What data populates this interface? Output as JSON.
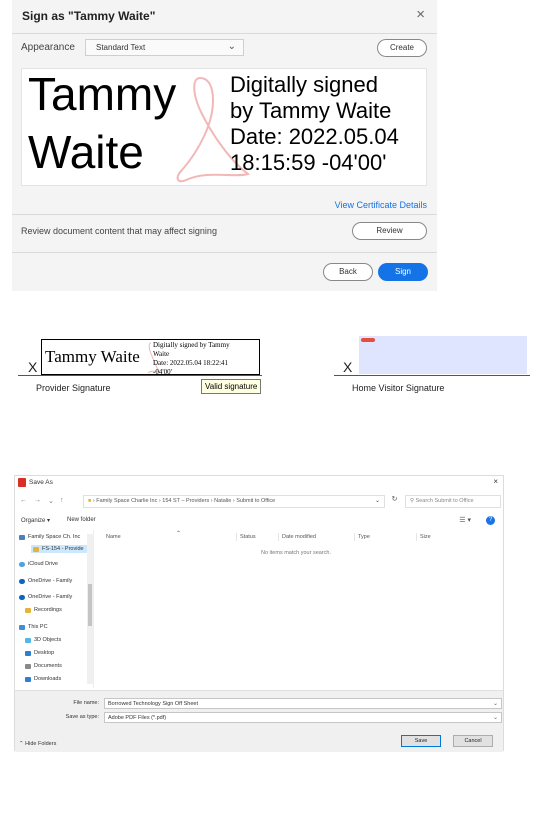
{
  "sign_dialog": {
    "title": "Sign as \"Tammy Waite\"",
    "close": "×",
    "appearance_label": "Appearance",
    "appearance_value": "Standard Text",
    "create_label": "Create",
    "preview": {
      "name_line1": "Tammy",
      "name_line2": "Waite",
      "detail_lines": [
        "Digitally signed",
        "by Tammy Waite",
        "Date: 2022.05.04",
        "18:15:59 -04'00'"
      ]
    },
    "view_certificate": "View Certificate Details",
    "review_text": "Review document content that may affect signing",
    "review_label": "Review",
    "back_label": "Back",
    "sign_label": "Sign",
    "accent_color": "#1473e6"
  },
  "signature_lines": {
    "x_mark": "X",
    "provider": {
      "caption": "Provider Signature",
      "signed_name": "Tammy Waite",
      "detail_lines": [
        "Digitally signed by Tammy",
        "Waite",
        "Date: 2022.05.04 18:22:41",
        "-04'00'"
      ],
      "tooltip": "Valid signature"
    },
    "home_visitor": {
      "caption": "Home Visitor Signature",
      "field_color": "#dfe4ff"
    }
  },
  "save_dialog": {
    "title": "Save As",
    "close": "×",
    "path": [
      "Family Space Charlie Inc",
      "154 ST – Providers",
      "Natalie",
      "Submit to Office"
    ],
    "search_placeholder": "Search Submit to Office",
    "organize_label": "Organize ▾",
    "new_folder_label": "New folder",
    "nav_items": [
      {
        "label": "Family Space Ch. Inc",
        "icon": "folder-icon"
      },
      {
        "label": "FS-154 - Provide",
        "icon": "folder-icon",
        "selected": true
      },
      {
        "label": "iCloud Drive",
        "icon": "cloud-icon"
      },
      {
        "label": "OneDrive - Family",
        "icon": "cloud-icon"
      },
      {
        "label": "OneDrive - Family",
        "icon": "cloud-icon"
      },
      {
        "label": "Recordings",
        "icon": "folder-icon"
      },
      {
        "label": "This PC",
        "icon": "computer-icon"
      },
      {
        "label": "3D Objects",
        "icon": "cube-icon"
      },
      {
        "label": "Desktop",
        "icon": "desktop-icon"
      },
      {
        "label": "Documents",
        "icon": "document-icon"
      },
      {
        "label": "Downloads",
        "icon": "download-icon"
      }
    ],
    "columns": [
      "Name",
      "Status",
      "Date modified",
      "Type",
      "Size"
    ],
    "empty_message": "No items match your search.",
    "file_name_label": "File name:",
    "file_name_value": "Borrowed Technology Sign Off Sheet",
    "save_as_type_label": "Save as type:",
    "save_as_type_value": "Adobe PDF Files (*.pdf)",
    "hide_folders": "Hide Folders",
    "save_label": "Save",
    "cancel_label": "Cancel"
  }
}
